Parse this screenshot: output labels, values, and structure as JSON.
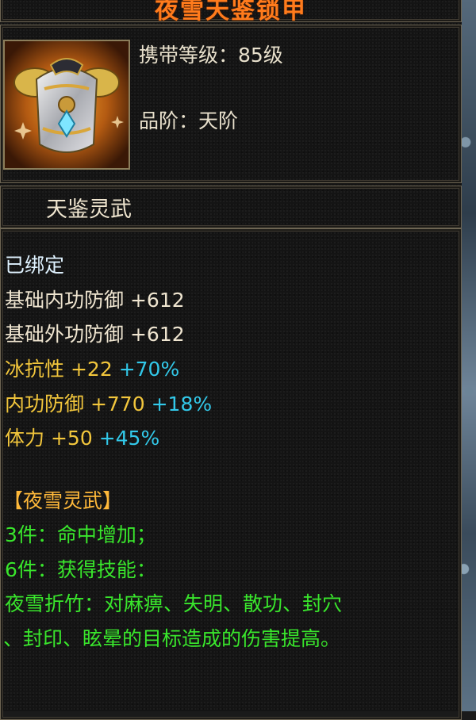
{
  "header": {
    "title": "夜雪天鉴锁甲"
  },
  "item": {
    "icon": "armor-chest-icon",
    "level_requirement": "携带等级：85级",
    "grade": "品阶：天阶",
    "name": "天鉴灵武"
  },
  "details": {
    "bound": "已绑定",
    "base_stats": [
      {
        "label": "基础内功防御",
        "value": "+612"
      },
      {
        "label": "基础外功防御",
        "value": "+612"
      }
    ],
    "bonus_stats": [
      {
        "label": "冰抗性",
        "value": "+22",
        "percent": "+70%"
      },
      {
        "label": "内功防御",
        "value": "+770",
        "percent": "+18%"
      },
      {
        "label": "体力",
        "value": "+50",
        "percent": "+45%"
      }
    ],
    "set": {
      "name": "【夜雪灵武】",
      "lines": [
        "3件：命中增加；",
        "6件：获得技能：",
        "夜雪折竹：对麻痹、失明、散功、封穴",
        "、封印、眩晕的目标造成的伤害提高。"
      ]
    }
  },
  "colors": {
    "title": "#ff7b1c",
    "base_stat": "#efe5d0",
    "bonus_stat": "#f2c63c",
    "percent": "#32c9ea",
    "set_text": "#39e62c",
    "set_name": "#ffb93a"
  }
}
